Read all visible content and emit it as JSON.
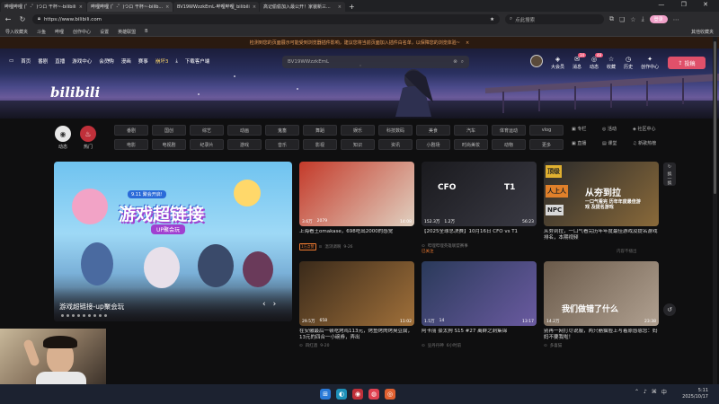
{
  "browser": {
    "tabs": [
      {
        "label": "哔哩哔哩 (゜-゜)つロ 干杯~-bilibili",
        "active": false
      },
      {
        "label": "哔哩哔哩 (゜-゜)つロ 干杯~-bilib...",
        "active": true
      },
      {
        "label": "BV19WWzzkEmL-哔哩哔哩_bilibili",
        "active": false
      },
      {
        "label": "高记偷偷加入最公开！家装新三...",
        "active": false
      }
    ],
    "new_tab": "+",
    "window_controls": "— ❐ ✕",
    "url": "https://www.bilibili.com",
    "search_placeholder": "点此搜索",
    "login_label": "登录",
    "bookmarks": [
      "导入收藏夹",
      "斗鱼",
      "哔哩",
      "创作中心",
      "设置",
      "英雄联盟",
      "B"
    ],
    "bookmarks_right": "其他收藏夹"
  },
  "notice": {
    "text": "检测到您的页面展示可能受到浏览器插件影响，建议您将当前页面加入插件白名单，以保障您的浏览体验~",
    "close": "×"
  },
  "header": {
    "nav": [
      "首页",
      "番剧",
      "直播",
      "游戏中心",
      "会员购",
      "漫画",
      "赛事",
      "崩坏3",
      "下载客户端"
    ],
    "nav_highlight_index": 7,
    "search_value": "BV19WWzzkEmL",
    "right_nav": [
      {
        "label": "大会员",
        "icon": "vip-icon",
        "glyph": "◈"
      },
      {
        "label": "消息",
        "icon": "message-icon",
        "glyph": "✉",
        "badge": "34"
      },
      {
        "label": "动态",
        "icon": "dynamic-icon",
        "glyph": "◎",
        "badge": "48"
      },
      {
        "label": "收藏",
        "icon": "star-icon",
        "glyph": "☆"
      },
      {
        "label": "历史",
        "icon": "history-icon",
        "glyph": "◷"
      },
      {
        "label": "创作中心",
        "icon": "bulb-icon",
        "glyph": "✦"
      }
    ],
    "upload_label": "投稿",
    "logo": "bilibili"
  },
  "channels": {
    "dynamic_label": "动态",
    "hot_label": "热门",
    "chips": [
      "番剧",
      "国创",
      "综艺",
      "动画",
      "鬼畜",
      "舞蹈",
      "娱乐",
      "科技数码",
      "美食",
      "汽车",
      "体育运动",
      "vlog",
      "电影",
      "电视剧",
      "纪录片",
      "游戏",
      "音乐",
      "影视",
      "知识",
      "资讯",
      "小剧场",
      "时尚美妆",
      "动物",
      "更多"
    ],
    "side_links": [
      "专栏",
      "活动",
      "社区中心",
      "直播",
      "课堂",
      "新歌热榜"
    ]
  },
  "feature": {
    "title": "游戏超链接-up聚会玩",
    "banner_text": "游戏超链接",
    "banner_sub": "UP聚会玩",
    "banner_date": "9.11 聚会开启!"
  },
  "cards": [
    {
      "title": "上海看王omakase，698吃出2000的感觉",
      "views": "3.6万",
      "danmaku": "2079",
      "duration": "14:08",
      "tag": "1万点赞",
      "author": "温浏调啊",
      "date": "9-26",
      "colors": [
        "#c43a2a",
        "#e0d0c0"
      ]
    },
    {
      "title": "【2025全球总决赛】10月16日 CFO vs T1",
      "views": "152.3万",
      "danmaku": "1.2万",
      "duration": "56:23",
      "tag": "",
      "author": "哔哩哔哩英雄联盟赛事",
      "date": "",
      "overlay_left": "CFO",
      "overlay_right": "T1",
      "colors": [
        "#1a1a1e",
        "#3a3a44"
      ]
    },
    {
      "title": "从夯到拉，一口气看完历年年度最佳游戏及提名游戏排名，本期视频",
      "views": "",
      "danmaku": "",
      "duration": "",
      "tag": "",
      "author": "",
      "date": "",
      "overlay_text": "从夯到拉",
      "overlay_sub": "一口气看完 历年年度最佳游戏 及提名游戏",
      "tiers": [
        "顶级",
        "人上人",
        "NPC"
      ],
      "colors": [
        "#2a2a2a",
        "#8a6a3a"
      ]
    },
    {
      "title": "在安徽最后一顿吃烤鸡113元，烤鱼烤肉烤臭豆腐，13元的四合一小碗券，弄出",
      "views": "29.5万",
      "danmaku": "658",
      "duration": "11:02",
      "tag": "",
      "author": "四红酒",
      "date": "9-20",
      "colors": [
        "#3a2a1a",
        "#a0703a"
      ]
    },
    {
      "title": "阿卡丽 豪太狗 S15 #27 离群之刺集锦",
      "views": "1.5万",
      "danmaku": "14",
      "duration": "13:17",
      "tag": "",
      "author": "豆丹丹神",
      "date": "6小时前",
      "colors": [
        "#2a3a5a",
        "#6a5aa0"
      ]
    },
    {
      "title": "别再一网打尽说服，两只崩猫脸上写着原感恩您：妈妈不要我啦！",
      "views": "14.2万",
      "danmaku": "",
      "duration": "23:38",
      "tag": "",
      "author": "多喜猫",
      "date": "",
      "overlay_text": "我们做错了什么",
      "colors": [
        "#6a5a4a",
        "#b0a090"
      ]
    }
  ],
  "card_meta_extra": {
    "card2": "已关注",
    "card1_tag": "1万点赞",
    "row1_col4_hidden": "内容不播出"
  },
  "float_buttons": {
    "refresh": "换一换",
    "back": "↺"
  },
  "taskbar": {
    "time": "5:11",
    "date": "2025/10/17"
  }
}
